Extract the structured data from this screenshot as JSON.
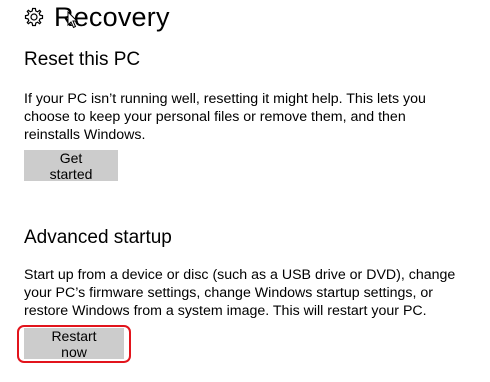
{
  "header": {
    "title": "Recovery",
    "icon": "gear-icon"
  },
  "reset": {
    "heading": "Reset this PC",
    "description": "If your PC isn’t running well, resetting it might help. This lets you choose to keep your personal files or remove them, and then reinstalls Windows.",
    "button_label": "Get started"
  },
  "advanced": {
    "heading": "Advanced startup",
    "description": "Start up from a device or disc (such as a USB drive or DVD), change your PC’s firmware settings, change Windows startup settings, or restore Windows from a system image. This will restart your PC.",
    "button_label": "Restart now"
  },
  "colors": {
    "button_bg": "#cccccc",
    "highlight": "#e2141c",
    "text": "#000000",
    "background": "#ffffff"
  }
}
